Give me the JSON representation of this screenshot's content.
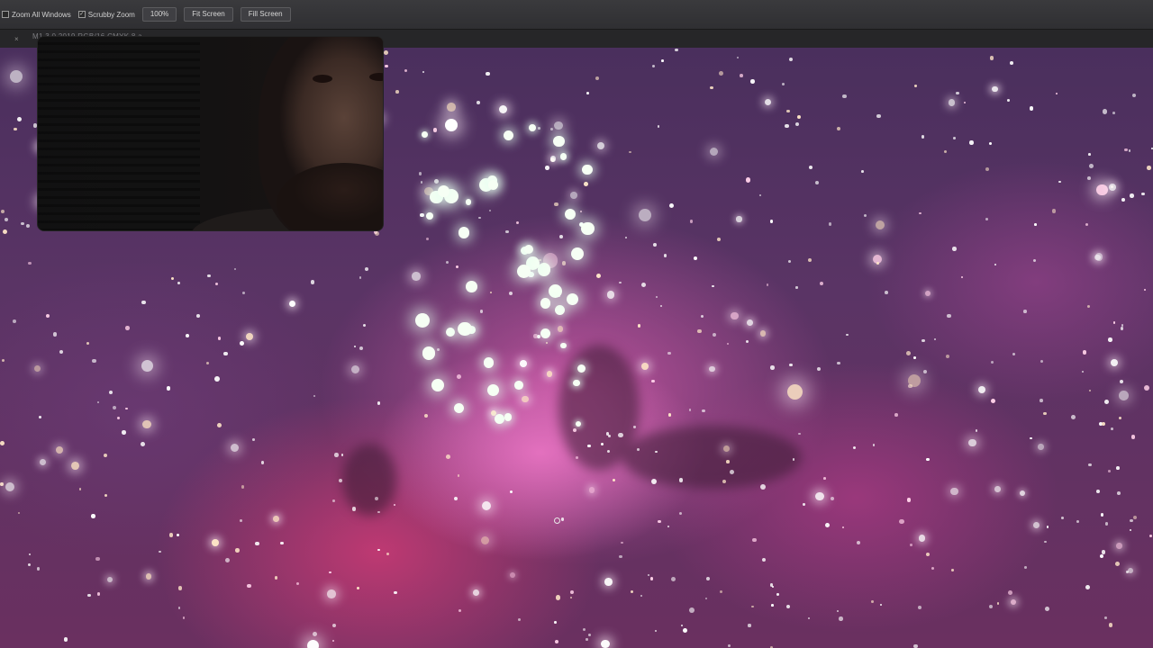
{
  "options_bar": {
    "zoom_all_windows": {
      "label": "Zoom All Windows",
      "checked": false
    },
    "scrubby_zoom": {
      "label": "Scrubby Zoom",
      "checked": true
    },
    "zoom_value": "100%",
    "fit_screen": "Fit Screen",
    "fill_screen": "Fill Screen"
  },
  "tab_strip": {
    "close_glyph": "×",
    "document_title": "M1 3 0 2019 RGB/16 CMYK 8 a"
  },
  "colors": {
    "toolbar_bg": "#333336",
    "canvas_nebula": "#d45aa8",
    "star": "#ffffff"
  }
}
